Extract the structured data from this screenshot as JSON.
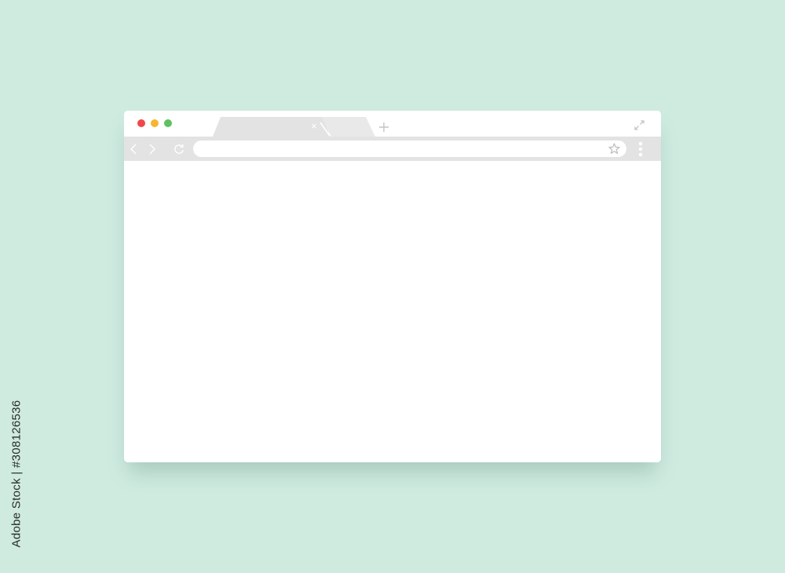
{
  "watermark": {
    "stock_id": "Adobe Stock | #308126536"
  },
  "window": {
    "controls": {
      "close_color": "#f04848",
      "minimize_color": "#f7b531",
      "maximize_color": "#5cc25f"
    },
    "tabs": [
      {
        "label": "",
        "close_icon": "×",
        "active": true
      },
      {
        "label": "",
        "active": false
      }
    ],
    "icons": {
      "new_tab": "plus-icon",
      "expand": "expand-icon",
      "back": "chevron-left-icon",
      "forward": "chevron-right-icon",
      "reload": "reload-icon",
      "bookmark": "star-icon",
      "menu": "kebab-menu-icon"
    },
    "address_bar": {
      "value": ""
    }
  },
  "colors": {
    "background": "#cfebe0",
    "window": "#ffffff",
    "toolbar": "#e3e3e3",
    "icon": "#c4c4c4"
  }
}
